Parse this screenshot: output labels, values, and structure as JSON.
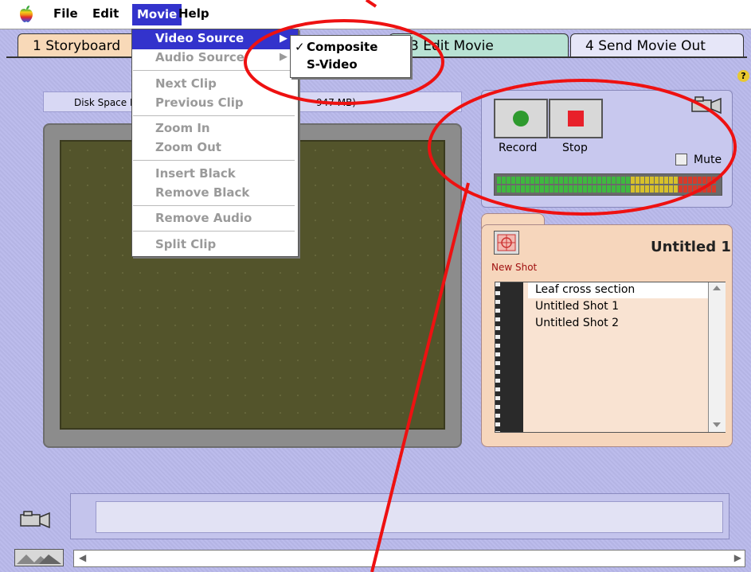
{
  "menubar": {
    "apple_icon": "apple-logo-icon",
    "items": [
      "File",
      "Edit",
      "Movie",
      "Help"
    ],
    "active": "Movie"
  },
  "tabs": [
    {
      "label": "1 Storyboard"
    },
    {
      "label": "3 Edit Movie"
    },
    {
      "label": "4 Send Movie Out"
    }
  ],
  "movie_menu": {
    "items": [
      {
        "label": "Video Source",
        "enabled": true,
        "highlighted": true,
        "submenu": true
      },
      {
        "label": "Audio Source",
        "enabled": false,
        "submenu": true
      },
      {
        "label": "Next Clip",
        "enabled": false
      },
      {
        "label": "Previous Clip",
        "enabled": false
      },
      {
        "label": "Zoom In",
        "enabled": false
      },
      {
        "label": "Zoom Out",
        "enabled": false
      },
      {
        "label": "Insert Black",
        "enabled": false
      },
      {
        "label": "Remove Black",
        "enabled": false
      },
      {
        "label": "Remove Audio",
        "enabled": false
      },
      {
        "label": "Split Clip",
        "enabled": false
      }
    ]
  },
  "video_source_submenu": {
    "items": [
      {
        "label": "Composite",
        "checked": true
      },
      {
        "label": "S-Video",
        "checked": false
      }
    ]
  },
  "monitor": {
    "disk_space_prefix": "Disk Space F",
    "disk_space_suffix": "947 MB)"
  },
  "record_panel": {
    "record_label": "Record",
    "stop_label": "Stop",
    "mute_label": "Mute",
    "record_color": "#2e9a2e",
    "stop_color": "#e8202a"
  },
  "shot_panel": {
    "new_shot_label": "New Shot",
    "title": "Untitled 1",
    "shots": [
      "Leaf cross section",
      "Untitled Shot 1",
      "Untitled Shot 2"
    ]
  },
  "help_glyph": "?",
  "annotation": {
    "color": "#ee1111"
  }
}
